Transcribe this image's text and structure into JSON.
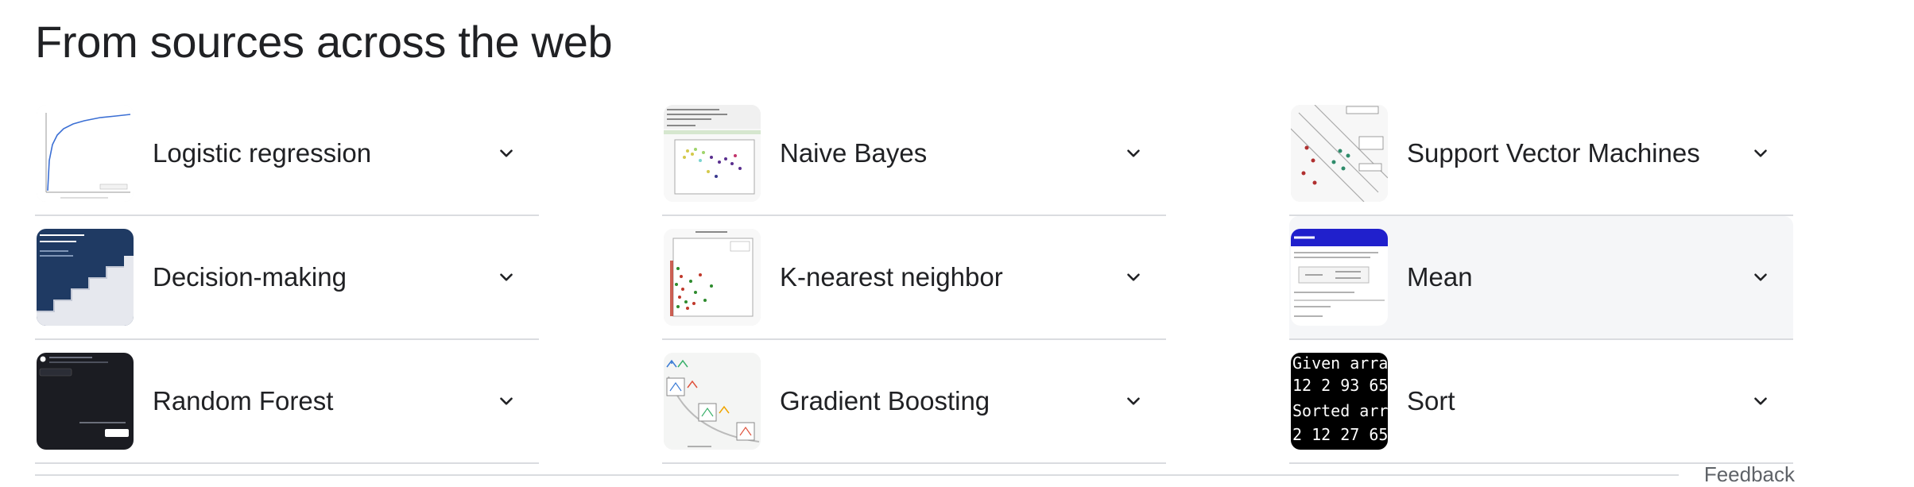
{
  "heading": "From sources across the web",
  "items": [
    {
      "label": "Logistic regression",
      "thumb": "roc-curve-chart-thumbnail"
    },
    {
      "label": "Naive Bayes",
      "thumb": "scatter-plot-code-thumbnail"
    },
    {
      "label": "Support Vector Machines",
      "thumb": "svm-diagram-thumbnail"
    },
    {
      "label": "Decision-making",
      "thumb": "decision-staircase-thumbnail"
    },
    {
      "label": "K-nearest neighbor",
      "thumb": "knn-scatter-thumbnail"
    },
    {
      "label": "Mean",
      "thumb": "mean-formula-thumbnail"
    },
    {
      "label": "Random Forest",
      "thumb": "dark-app-screenshot-thumbnail"
    },
    {
      "label": "Gradient Boosting",
      "thumb": "boosting-diagram-thumbnail"
    },
    {
      "label": "Sort",
      "thumb": "terminal-output-thumbnail",
      "terminal_lines": [
        "Given arra",
        "12 2 93 65",
        "Sorted arr",
        "2 12 27 65"
      ]
    }
  ],
  "footer": {
    "feedback_label": "Feedback"
  }
}
